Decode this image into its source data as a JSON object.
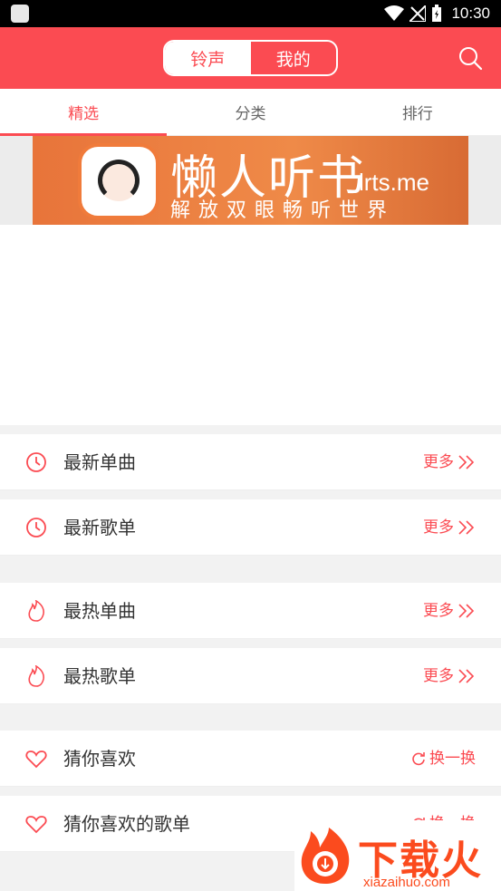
{
  "status_bar": {
    "time": "10:30"
  },
  "header": {
    "segments": [
      {
        "label": "铃声"
      },
      {
        "label": "我的"
      }
    ],
    "accent": "#fb4b52"
  },
  "tabs": [
    {
      "label": "精选"
    },
    {
      "label": "分类"
    },
    {
      "label": "排行"
    }
  ],
  "banner": {
    "title": "懒人听书",
    "domain": "lrts.me",
    "slogan": "解放双眼畅听世界"
  },
  "sections": [
    {
      "label": "最新单曲",
      "action": "更多",
      "icon": "clock-icon"
    },
    {
      "label": "最新歌单",
      "action": "更多",
      "icon": "clock-icon"
    },
    {
      "label": "最热单曲",
      "action": "更多",
      "icon": "flame-icon"
    },
    {
      "label": "最热歌单",
      "action": "更多",
      "icon": "flame-icon"
    },
    {
      "label": "猜你喜欢",
      "action": "换一换",
      "icon": "heart-icon"
    },
    {
      "label": "猜你喜欢的歌单",
      "action": "换一换",
      "icon": "heart-icon"
    }
  ],
  "watermark": {
    "text": "下载火",
    "url": "xiazaihuo.com"
  }
}
